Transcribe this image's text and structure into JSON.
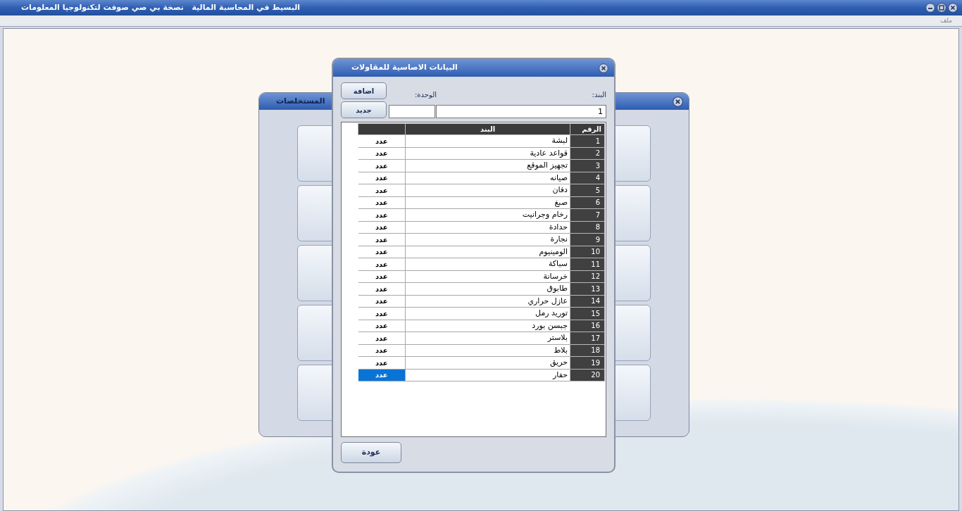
{
  "window": {
    "title": "البسيط في المحاسبة المالية   نصخة بي صي صوفت لتكنولوجيا المعلومات"
  },
  "menu": [
    "ملف"
  ],
  "background_window": {
    "title": "المستخلصات"
  },
  "dialog": {
    "title": "البيانات الاصاسية للمقاولات",
    "buttons": [
      "اضافة",
      "جديد"
    ],
    "item_field": {
      "label": "البند:",
      "value": "1"
    },
    "unit_field": {
      "label": "الوحدة:"
    },
    "table": {
      "columns": [
        "الرقم",
        "البند"
      ],
      "rows": [
        {
          "number": "1",
          "item": "لبشة",
          "unit": "عدد",
          "selected": false
        },
        {
          "number": "2",
          "item": "قواعد عادية",
          "unit": "عدد",
          "selected": false
        },
        {
          "number": "3",
          "item": "تجهيز الموقع",
          "unit": "عدد",
          "selected": false
        },
        {
          "number": "4",
          "item": "صيانه",
          "unit": "عدد",
          "selected": false
        },
        {
          "number": "5",
          "item": "دفان",
          "unit": "عدد",
          "selected": false
        },
        {
          "number": "6",
          "item": "صبغ",
          "unit": "عدد",
          "selected": false
        },
        {
          "number": "7",
          "item": "رخام وجرانيت",
          "unit": "عدد",
          "selected": false
        },
        {
          "number": "8",
          "item": "حدادة",
          "unit": "عدد",
          "selected": false
        },
        {
          "number": "9",
          "item": "نجارة",
          "unit": "عدد",
          "selected": false
        },
        {
          "number": "10",
          "item": "الومينيوم",
          "unit": "عدد",
          "selected": false
        },
        {
          "number": "11",
          "item": "سباكة",
          "unit": "عدد",
          "selected": false
        },
        {
          "number": "12",
          "item": "خرسانة",
          "unit": "عدد",
          "selected": false
        },
        {
          "number": "13",
          "item": "طابوق",
          "unit": "عدد",
          "selected": false
        },
        {
          "number": "14",
          "item": "عازل حراري",
          "unit": "عدد",
          "selected": false
        },
        {
          "number": "15",
          "item": "توريد رمل",
          "unit": "عدد",
          "selected": false
        },
        {
          "number": "16",
          "item": "جبسن بورد",
          "unit": "عدد",
          "selected": false
        },
        {
          "number": "17",
          "item": "بلاستر",
          "unit": "عدد",
          "selected": false
        },
        {
          "number": "18",
          "item": "بلاط",
          "unit": "عدد",
          "selected": false
        },
        {
          "number": "19",
          "item": "حريق",
          "unit": "عدد",
          "selected": false
        },
        {
          "number": "20",
          "item": "حفار",
          "unit": "عدد",
          "selected": true
        }
      ]
    },
    "back_button": "عودة"
  }
}
